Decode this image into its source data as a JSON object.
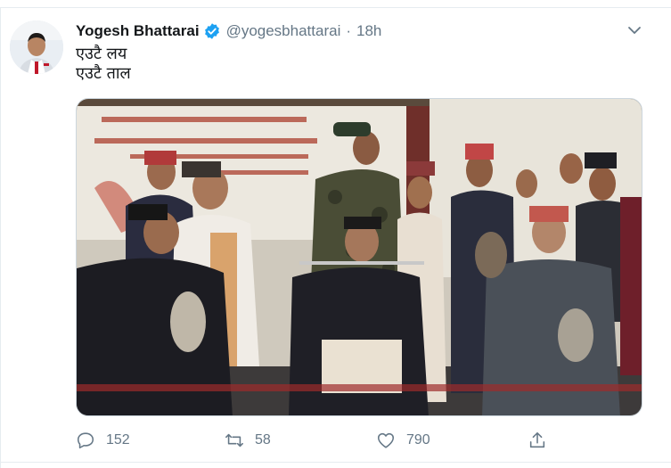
{
  "tweet": {
    "author": {
      "display_name": "Yogesh Bhattarai",
      "handle": "@yogesbhattarai",
      "verified": true,
      "avatar": "profile-photo"
    },
    "separator": "·",
    "time": "18h",
    "text_lines": [
      "एउटै लय",
      "एउटै ताल"
    ],
    "media": {
      "kind": "photo",
      "description_icon": "photo-group-musicians"
    },
    "actions": {
      "reply": {
        "icon": "reply-icon",
        "count": "152"
      },
      "retweet": {
        "icon": "retweet-icon",
        "count": "58"
      },
      "like": {
        "icon": "heart-icon",
        "count": "790"
      },
      "share": {
        "icon": "share-icon"
      }
    },
    "menu_icon": "chevron-down-icon"
  },
  "colors": {
    "text": "#14171a",
    "muted": "#657786",
    "verified": "#1da1f2",
    "border": "#e6ecf0"
  }
}
